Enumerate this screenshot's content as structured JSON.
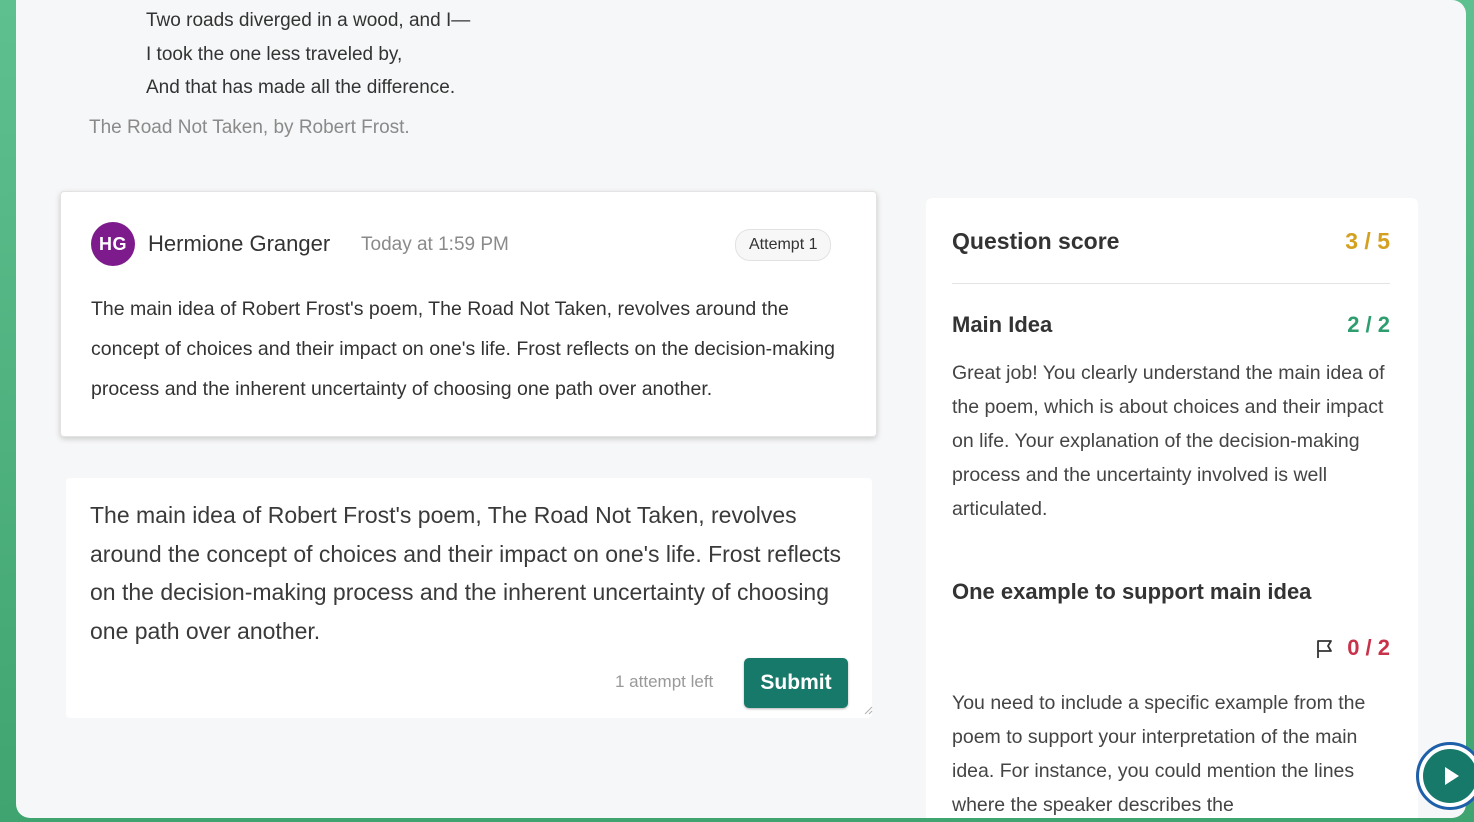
{
  "poem": {
    "lines": [
      "Two roads diverged in a wood, and I—",
      "I took the one less traveled by,",
      "And that has made all the difference."
    ],
    "source": "The Road Not Taken, by Robert Frost."
  },
  "submission": {
    "avatar_initials": "HG",
    "student_name": "Hermione Granger",
    "timestamp": "Today at 1:59 PM",
    "attempt_label": "Attempt 1",
    "answer": "The main idea of Robert Frost's poem, The Road Not Taken, revolves around the concept of choices and their impact on one's life. Frost reflects on the decision-making process and the inherent uncertainty of choosing one path over another."
  },
  "editor": {
    "text": "The main idea of Robert Frost's poem, The Road Not Taken, revolves around the concept of choices and their impact on one's life. Frost reflects on the decision-making process and the inherent uncertainty of choosing one path over another.",
    "attempts_left": "1 attempt left",
    "submit_label": "Submit"
  },
  "score": {
    "label": "Question score",
    "value": "3 / 5",
    "criteria": [
      {
        "title": "Main Idea",
        "score": "2 / 2",
        "feedback": "Great job! You clearly understand the main idea of the poem, which is about choices and their impact on life. Your explanation of the decision-making process and the uncertainty involved is well articulated."
      },
      {
        "title": "One example to support main idea",
        "score": "0 / 2",
        "feedback": "You need to include a specific example from the poem to support your interpretation of the main idea. For instance, you could mention the lines where the speaker describes the"
      }
    ]
  },
  "colors": {
    "accent": "#17796a",
    "avatar": "#7d1a8c",
    "score_partial": "#d4a020",
    "score_full": "#2e9e6f",
    "score_zero": "#c8324a"
  },
  "icons": [
    "flag-icon",
    "play-icon",
    "resize-handle-icon"
  ]
}
